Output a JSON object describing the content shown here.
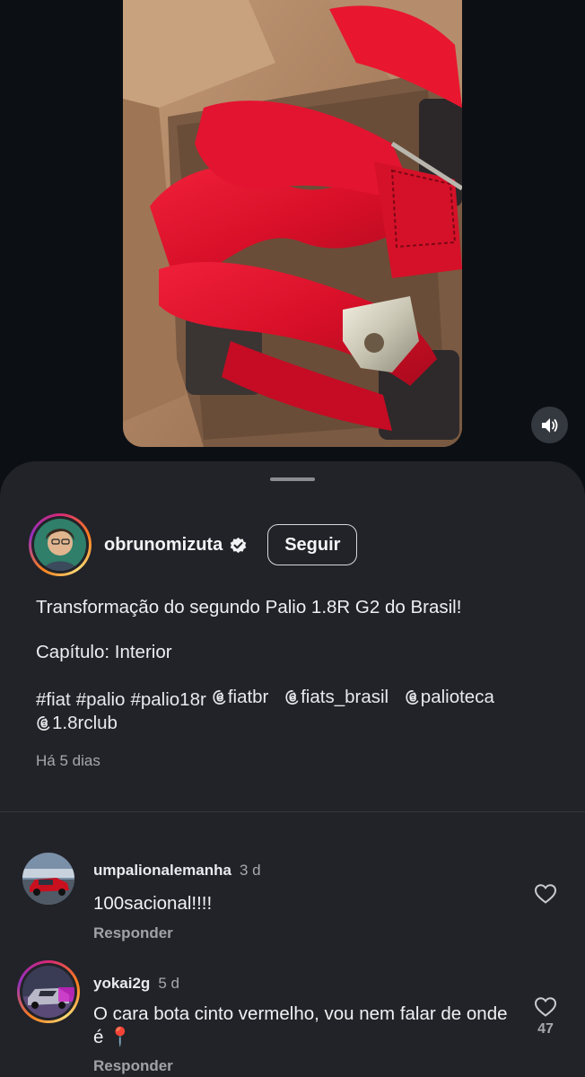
{
  "media": {
    "description_icon": "video-frame",
    "sound_icon": "speaker-on-icon"
  },
  "post": {
    "author": {
      "username": "obrunomizuta",
      "verified": true,
      "follow_label": "Seguir"
    },
    "caption": {
      "line1": "Transformação do segundo Palio 1.8R G2 do Brasil!",
      "line2": "Capítulo: Interior",
      "hashtags": [
        "#fiat",
        "#palio",
        "#palio18r"
      ],
      "mentions": [
        "fiatbr",
        "fiats_brasil",
        "palioteca",
        "1.8rclub"
      ]
    },
    "time_ago": "Há 5 dias"
  },
  "comments": [
    {
      "username": "umpalionalemanha",
      "time": "3 d",
      "text": "100sacional!!!!",
      "reply_label": "Responder",
      "likes": ""
    },
    {
      "username": "yokai2g",
      "time": "5 d",
      "text": "O cara bota cinto vermelho, vou nem falar de onde é 📍",
      "reply_label": "Responder",
      "likes": "47"
    }
  ],
  "colors": {
    "background": "#0c0f14",
    "sheet": "#222328",
    "text_primary": "#f2f3f5",
    "text_secondary": "#a5a8ae",
    "belt_red": "#e0122b"
  }
}
